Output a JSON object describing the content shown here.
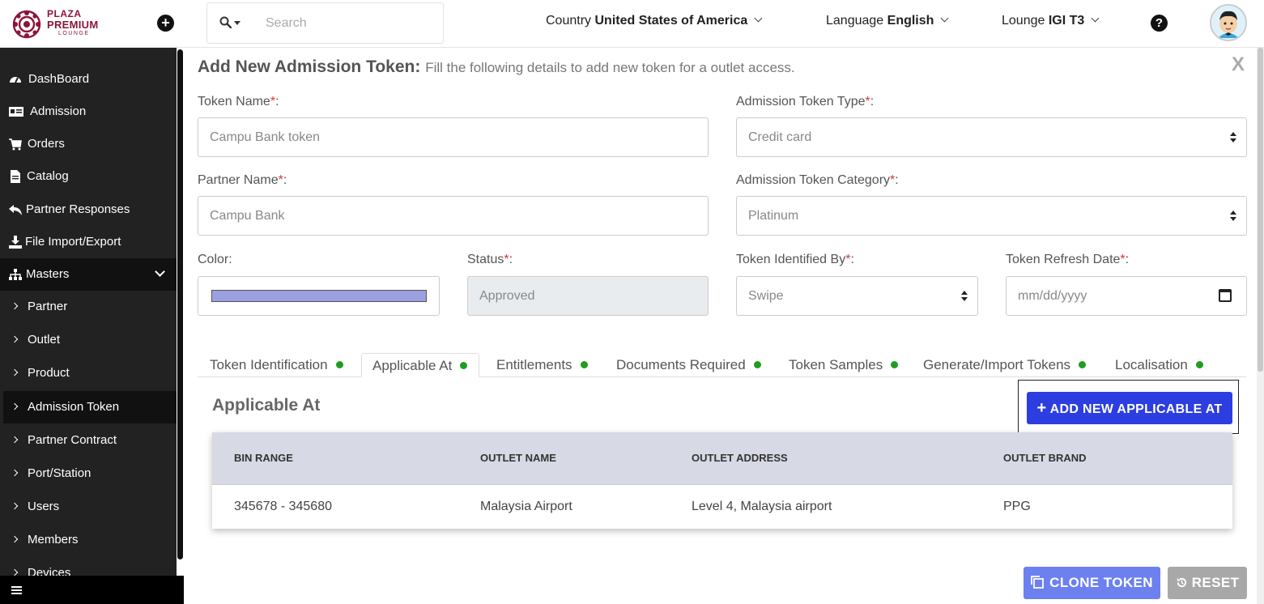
{
  "header": {
    "logo": {
      "line1": "PLAZA",
      "line2": "PREMIUM",
      "line3": "LOUNGE"
    },
    "add_icon": "plus-circle-icon",
    "search": {
      "placeholder": "Search",
      "value": ""
    },
    "country": {
      "label": "Country",
      "value": "United States of America"
    },
    "language": {
      "label": "Language",
      "value": "English"
    },
    "lounge": {
      "label": "Lounge",
      "value": "IGI T3"
    },
    "help_icon": "question-circle-icon",
    "help_glyph": "?"
  },
  "sidebar": {
    "items": [
      {
        "label": "DashBoard",
        "icon": "dashboard-icon"
      },
      {
        "label": "Admission",
        "icon": "id-card-icon"
      },
      {
        "label": "Orders",
        "icon": "cart-icon"
      },
      {
        "label": "Catalog",
        "icon": "file-icon"
      },
      {
        "label": "Partner Responses",
        "icon": "reply-all-icon"
      },
      {
        "label": "File Import/Export",
        "icon": "download-icon"
      },
      {
        "label": "Masters",
        "icon": "sitemap-icon"
      }
    ],
    "sub_items": [
      {
        "label": "Partner"
      },
      {
        "label": "Outlet"
      },
      {
        "label": "Product"
      },
      {
        "label": "Admission Token"
      },
      {
        "label": "Partner Contract"
      },
      {
        "label": "Port/Station"
      },
      {
        "label": "Users"
      },
      {
        "label": "Members"
      },
      {
        "label": "Devices"
      }
    ],
    "active_sub_item": "Admission Token"
  },
  "form": {
    "title": "Add New Admission Token:",
    "subtitle": "Fill the following details to add new token for a outlet access.",
    "close": "X",
    "required_mark": "*",
    "fields": {
      "token_name": {
        "label": "Token Name",
        "value": "Campu Bank token"
      },
      "token_type": {
        "label": "Admission Token Type",
        "value": "Credit card"
      },
      "partner_name": {
        "label": "Partner Name",
        "value": "Campu Bank"
      },
      "token_category": {
        "label": "Admission Token Category",
        "value": "Platinum"
      },
      "color": {
        "label": "Color:",
        "value": "#9aa0e0"
      },
      "status": {
        "label": "Status",
        "value": "Approved"
      },
      "identified_by": {
        "label": "Token Identified By",
        "value": "Swipe"
      },
      "refresh_date": {
        "label": "Token Refresh Date",
        "placeholder": "mm/dd/yyyy"
      }
    }
  },
  "tabs": [
    {
      "label": "Token Identification"
    },
    {
      "label": "Applicable At"
    },
    {
      "label": "Entitlements"
    },
    {
      "label": "Documents Required"
    },
    {
      "label": "Token Samples"
    },
    {
      "label": "Generate/Import Tokens"
    },
    {
      "label": "Localisation"
    }
  ],
  "active_tab": "Applicable At",
  "applicable_at": {
    "title": "Applicable At",
    "add_button": "ADD NEW APPLICABLE AT",
    "table": {
      "columns": [
        "BIN RANGE",
        "OUTLET NAME",
        "OUTLET ADDRESS",
        "OUTLET BRAND"
      ],
      "rows": [
        [
          "345678 - 345680",
          "Malaysia Airport",
          "Level 4, Malaysia airport",
          "PPG"
        ]
      ]
    }
  },
  "footer": {
    "clone_button": "CLONE TOKEN",
    "reset_button": "RESET"
  },
  "colors": {
    "sidebar_bg": "#222222",
    "primary_button": "#2c3ee0",
    "clone_button": "#6c80f0",
    "reset_button": "#a8a8a8",
    "tab_dot": "#1f9d1f",
    "required": "#dd3333",
    "brand": "#8a1538"
  }
}
